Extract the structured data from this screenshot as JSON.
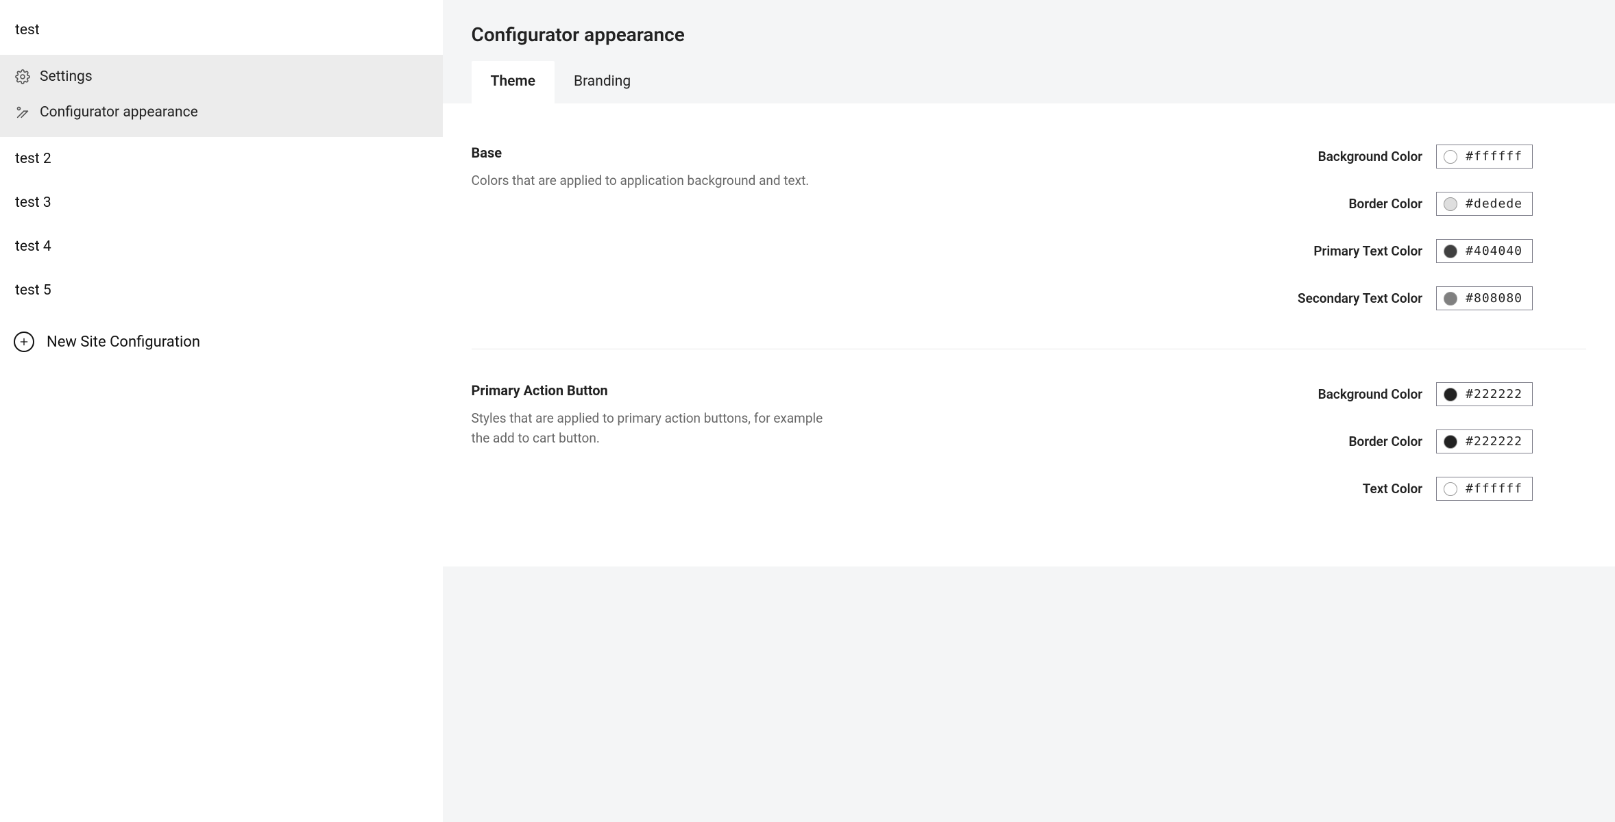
{
  "sidebar": {
    "sites": [
      {
        "name": "test",
        "expanded": true
      },
      {
        "name": "test 2",
        "expanded": false
      },
      {
        "name": "test 3",
        "expanded": false
      },
      {
        "name": "test 4",
        "expanded": false
      },
      {
        "name": "test 5",
        "expanded": false
      }
    ],
    "subnav": {
      "settings_label": "Settings",
      "appearance_label": "Configurator appearance"
    },
    "new_site_label": "New Site Configuration"
  },
  "page": {
    "title": "Configurator appearance",
    "tabs": [
      {
        "label": "Theme",
        "active": true
      },
      {
        "label": "Branding",
        "active": false
      }
    ]
  },
  "theme": {
    "sections": [
      {
        "title": "Base",
        "description": "Colors that are applied to application background and text.",
        "colors": [
          {
            "label": "Background Color",
            "value": "#ffffff",
            "swatch": "#ffffff"
          },
          {
            "label": "Border Color",
            "value": "#dedede",
            "swatch": "#dedede"
          },
          {
            "label": "Primary Text Color",
            "value": "#404040",
            "swatch": "#404040"
          },
          {
            "label": "Secondary Text Color",
            "value": "#808080",
            "swatch": "#808080"
          }
        ]
      },
      {
        "title": "Primary Action Button",
        "description": "Styles that are applied to primary action buttons, for example the add to cart button.",
        "colors": [
          {
            "label": "Background Color",
            "value": "#222222",
            "swatch": "#222222"
          },
          {
            "label": "Border Color",
            "value": "#222222",
            "swatch": "#222222"
          },
          {
            "label": "Text Color",
            "value": "#ffffff",
            "swatch": "#ffffff"
          }
        ]
      }
    ]
  }
}
